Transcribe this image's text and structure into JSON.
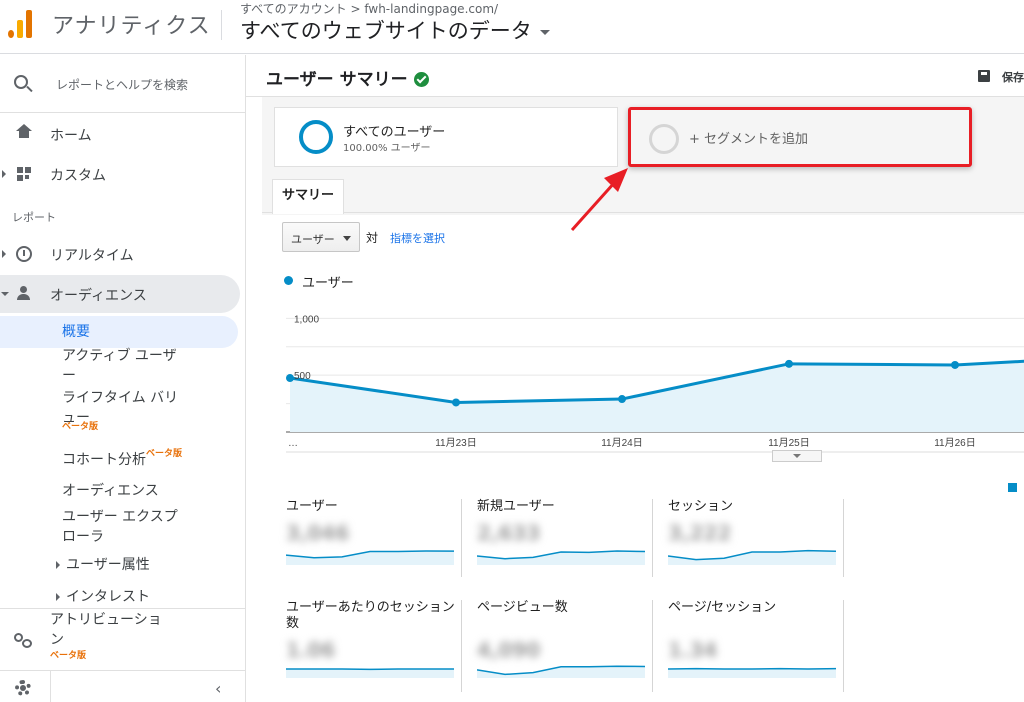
{
  "header": {
    "app_title": "アナリティクス",
    "breadcrumb": "すべてのアカウント > fwh-landingpage.com/",
    "view_title": "すべてのウェブサイトのデータ"
  },
  "sidebar": {
    "search_label": "レポートとヘルプを検索",
    "home": "ホーム",
    "custom": "カスタム",
    "section_reports": "レポート",
    "realtime": "リアルタイム",
    "audience": "オーディエンス",
    "sub_overview": "概要",
    "sub_active_users": "アクティブ ユーザー",
    "sub_lifetime_value": "ライフタイム バリュー",
    "sub_cohort": "コホート分析",
    "sub_audiences": "オーディエンス",
    "sub_user_explorer": "ユーザー エクスプローラ",
    "sub_demographics": "ユーザー属性",
    "sub_interests": "インタレスト",
    "attribution": "アトリビューション",
    "beta_label": "ベータ版"
  },
  "report": {
    "title": "ユーザー サマリー",
    "save_label": "保存"
  },
  "segments": {
    "all_users_name": "すべてのユーザー",
    "all_users_pct": "100.00% ユーザー",
    "add_segment": "+ セグメントを追加"
  },
  "tabs": {
    "summary": "サマリー"
  },
  "metric_selector": {
    "selected": "ユーザー",
    "vs": "対",
    "pick_metric": "指標を選択"
  },
  "chart_legend": "ユーザー",
  "chart_data": {
    "type": "line",
    "series": [
      {
        "name": "ユーザー",
        "values": [
          475,
          260,
          290,
          600,
          590,
          625
        ]
      }
    ],
    "x": [
      "…",
      "11月23日",
      "11月24日",
      "11月25日",
      "11月26日",
      ""
    ],
    "y_tick_labels": [
      "1,000",
      "500"
    ],
    "ylim": [
      0,
      1100
    ],
    "grid": true
  },
  "tiles": [
    {
      "name": "ユーザー",
      "value": "3,046",
      "spark": [
        0.55,
        0.4,
        0.45,
        0.75,
        0.75,
        0.78,
        0.77
      ]
    },
    {
      "name": "新規ユーザー",
      "value": "2,633",
      "spark": [
        0.5,
        0.35,
        0.42,
        0.72,
        0.7,
        0.78,
        0.75
      ]
    },
    {
      "name": "セッション",
      "value": "3,222",
      "spark": [
        0.5,
        0.3,
        0.38,
        0.72,
        0.72,
        0.8,
        0.76
      ]
    },
    {
      "name": "ユーザーあたりのセッション数",
      "value": "1.06",
      "spark": [
        0.5,
        0.5,
        0.5,
        0.48,
        0.5,
        0.5,
        0.5
      ]
    },
    {
      "name": "ページビュー数",
      "value": "4,090",
      "spark": [
        0.45,
        0.2,
        0.3,
        0.62,
        0.62,
        0.65,
        0.64
      ]
    },
    {
      "name": "ページ/セッション",
      "value": "1.34",
      "spark": [
        0.5,
        0.52,
        0.5,
        0.5,
        0.52,
        0.5,
        0.52
      ]
    }
  ],
  "colors": {
    "accent": "#058dc7",
    "highlight": "#e81e25",
    "fill": "#e4f3fa"
  }
}
